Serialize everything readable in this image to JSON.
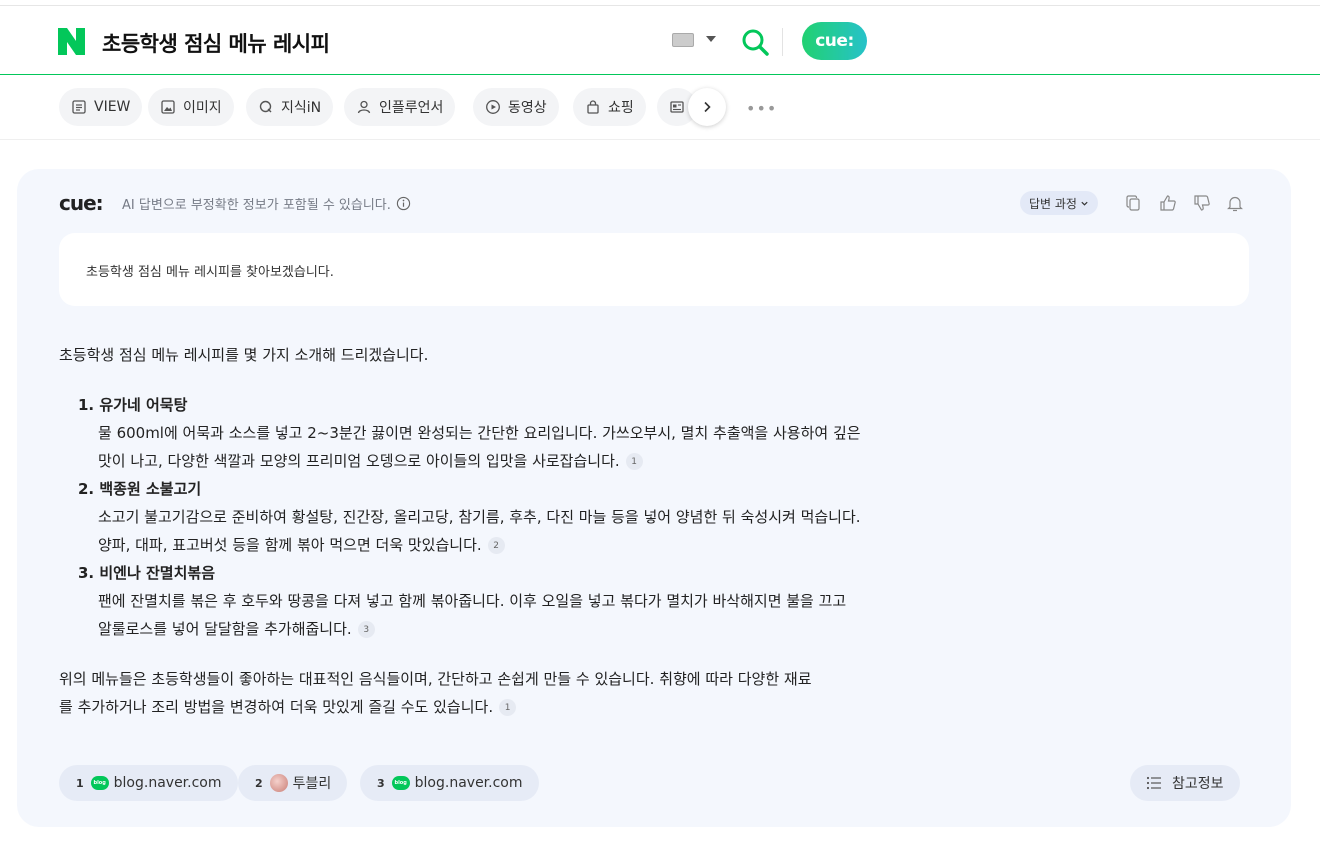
{
  "header": {
    "query": "초등학생 점심 메뉴 레시피",
    "cue_button": "cue:"
  },
  "tabs": [
    {
      "label": "VIEW",
      "icon": "document-icon"
    },
    {
      "label": "이미지",
      "icon": "image-icon"
    },
    {
      "label": "지식iN",
      "icon": "q-icon"
    },
    {
      "label": "인플루언서",
      "icon": "person-icon"
    },
    {
      "label": "동영상",
      "icon": "play-icon"
    },
    {
      "label": "쇼핑",
      "icon": "bag-icon"
    },
    {
      "label": "",
      "icon": "news-icon"
    }
  ],
  "more_label": "•••",
  "cue": {
    "logo": "cue:",
    "disclaimer": "AI 답변으로 부정확한 정보가 포함될 수 있습니다.",
    "process_button": "답변 과정",
    "query_text": "초등학생 점심 메뉴 레시피를 찾아보겠습니다.",
    "intro": "초등학생 점심 메뉴 레시피를 몇 가지 소개해 드리겠습니다.",
    "items": [
      {
        "num": "1.",
        "title": "유가네 어묵탕",
        "body1": "물 600ml에 어묵과 소스를 넣고 2~3분간 끓이면 완성되는 간단한 요리입니다. 가쓰오부시, 멸치 추출액을 사용하여 깊은",
        "body2": "맛이 나고, 다양한 색깔과 모양의 프리미엄 오뎅으로 아이들의 입맛을 사로잡습니다.",
        "cite": "1"
      },
      {
        "num": "2.",
        "title": "백종원 소불고기",
        "body1": "소고기 불고기감으로 준비하여 황설탕, 진간장, 올리고당, 참기름, 후추, 다진 마늘 등을 넣어 양념한 뒤 숙성시켜 먹습니다.",
        "body2": "양파, 대파, 표고버섯 등을 함께 볶아 먹으면 더욱 맛있습니다.",
        "cite": "2"
      },
      {
        "num": "3.",
        "title": "비엔나 잔멸치볶음",
        "body1": "팬에 잔멸치를 볶은 후 호두와 땅콩을 다져 넣고 함께 볶아줍니다. 이후 오일을 넣고 볶다가 멸치가 바삭해지면 불을 끄고",
        "body2": "알룰로스를 넣어 달달함을 추가해줍니다.",
        "cite": "3"
      }
    ],
    "outro1": "위의 메뉴들은 초등학생들이 좋아하는 대표적인 음식들이며, 간단하고 손쉽게 만들 수 있습니다. 취향에 따라 다양한 재료",
    "outro2": "를 추가하거나 조리 방법을 변경하여 더욱 맛있게 즐길 수도 있습니다.",
    "outro_cite": "1",
    "sources": [
      {
        "num": "1",
        "label": "blog.naver.com",
        "icon": "blog-icon"
      },
      {
        "num": "2",
        "label": "투블리",
        "icon": "avatar"
      },
      {
        "num": "3",
        "label": "blog.naver.com",
        "icon": "blog-icon"
      }
    ],
    "blog_icon_text": "blog",
    "ref_button": "참고정보"
  },
  "colors": {
    "brand": "#03c75a",
    "card_bg": "#f4f7fd"
  }
}
